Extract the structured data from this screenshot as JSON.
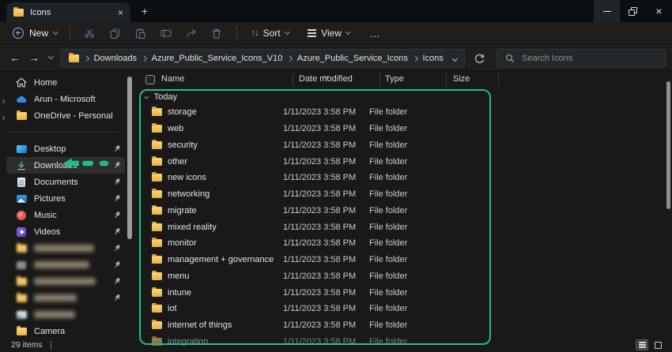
{
  "accent": {
    "annotation_green": "#1fbd8e",
    "toolbar_icon_blue": "#5d7890",
    "folder_yellow": "#f2c94c"
  },
  "window": {
    "tab_title": "Icons",
    "tab_close": "×",
    "new_tab_button": "+",
    "controls": [
      "minimize",
      "restore",
      "close"
    ]
  },
  "toolbar": {
    "new_label": "New",
    "actions": [
      "cut",
      "copy",
      "paste",
      "rename",
      "share",
      "delete"
    ],
    "sort_label": "Sort",
    "sort_glyph": "↑↓",
    "view_label": "View",
    "more_glyph": "…"
  },
  "addressbar": {
    "nav": [
      "back",
      "forward",
      "recent-locations",
      "up"
    ],
    "back_glyph": "←",
    "forward_glyph": "→",
    "up_glyph": "↑",
    "breadcrumbs": [
      "Downloads",
      "Azure_Public_Service_Icons_V10",
      "Azure_Public_Service_Icons",
      "Icons"
    ]
  },
  "search": {
    "placeholder": "Search Icons"
  },
  "sidebar": {
    "top_items": [
      {
        "label": "Home",
        "icon": "home-icon",
        "expandable": false,
        "pinned": false
      },
      {
        "label": "Arun - Microsoft",
        "icon": "onedrive-cloud-icon",
        "expandable": true,
        "pinned": false
      },
      {
        "label": "OneDrive - Personal",
        "icon": "folder-icon",
        "expandable": true,
        "pinned": false
      }
    ],
    "pinned_items": [
      {
        "label": "Desktop",
        "icon": "desktop-icon",
        "pinned": true
      },
      {
        "label": "Downloads",
        "icon": "downloads-icon",
        "pinned": true,
        "selected": true,
        "annotated": true
      },
      {
        "label": "Documents",
        "icon": "document-icon",
        "pinned": true
      },
      {
        "label": "Pictures",
        "icon": "pictures-icon",
        "pinned": true
      },
      {
        "label": "Music",
        "icon": "music-icon",
        "pinned": true
      },
      {
        "label": "Videos",
        "icon": "videos-icon",
        "pinned": true
      },
      {
        "label": "",
        "blurred": true,
        "blur_width": 76,
        "icon": "folder-icon",
        "pinned": true
      },
      {
        "label": "",
        "blurred": true,
        "blur_width": 70,
        "icon": "drive-icon",
        "pinned": true
      },
      {
        "label": "",
        "blurred": true,
        "blur_width": 78,
        "icon": "folder-icon",
        "pinned": true
      },
      {
        "label": "",
        "blurred": true,
        "blur_width": 54,
        "icon": "folder-icon",
        "pinned": true
      },
      {
        "label": "",
        "blurred": true,
        "blur_width": 52,
        "icon": "disk-icon",
        "pinned": false
      },
      {
        "label": "Camera",
        "icon": "folder-icon",
        "pinned": false
      }
    ]
  },
  "list": {
    "columns": [
      {
        "label": "Name"
      },
      {
        "label": "Date modified",
        "sorted": true
      },
      {
        "label": "Type"
      },
      {
        "label": "Size"
      }
    ],
    "group_label": "Today",
    "rows": [
      {
        "name": "storage",
        "date": "1/11/2023 3:58 PM",
        "type": "File folder",
        "size": ""
      },
      {
        "name": "web",
        "date": "1/11/2023 3:58 PM",
        "type": "File folder",
        "size": ""
      },
      {
        "name": "security",
        "date": "1/11/2023 3:58 PM",
        "type": "File folder",
        "size": ""
      },
      {
        "name": "other",
        "date": "1/11/2023 3:58 PM",
        "type": "File folder",
        "size": ""
      },
      {
        "name": "new icons",
        "date": "1/11/2023 3:58 PM",
        "type": "File folder",
        "size": ""
      },
      {
        "name": "networking",
        "date": "1/11/2023 3:58 PM",
        "type": "File folder",
        "size": ""
      },
      {
        "name": "migrate",
        "date": "1/11/2023 3:58 PM",
        "type": "File folder",
        "size": ""
      },
      {
        "name": "mixed reality",
        "date": "1/11/2023 3:58 PM",
        "type": "File folder",
        "size": ""
      },
      {
        "name": "monitor",
        "date": "1/11/2023 3:58 PM",
        "type": "File folder",
        "size": ""
      },
      {
        "name": "management + governance",
        "date": "1/11/2023 3:58 PM",
        "type": "File folder",
        "size": ""
      },
      {
        "name": "menu",
        "date": "1/11/2023 3:58 PM",
        "type": "File folder",
        "size": ""
      },
      {
        "name": "intune",
        "date": "1/11/2023 3:58 PM",
        "type": "File folder",
        "size": ""
      },
      {
        "name": "iot",
        "date": "1/11/2023 3:58 PM",
        "type": "File folder",
        "size": ""
      },
      {
        "name": "internet of things",
        "date": "1/11/2023 3:58 PM",
        "type": "File folder",
        "size": ""
      },
      {
        "name": "integration",
        "date": "1/11/2023 3:58 PM",
        "type": "File folder",
        "size": "",
        "clipped": true
      }
    ]
  },
  "statusbar": {
    "items_count": "29 items"
  }
}
